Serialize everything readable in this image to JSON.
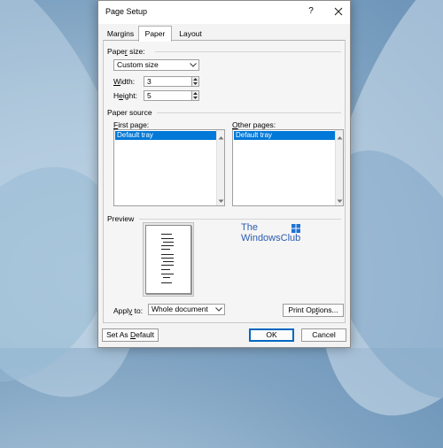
{
  "dialog": {
    "title": "Page Setup",
    "help_label": "?",
    "tabs": [
      {
        "label": "Margins",
        "active": false
      },
      {
        "label": "Paper",
        "active": true
      },
      {
        "label": "Layout",
        "active": false
      }
    ]
  },
  "paper_size": {
    "section_label_pre": "Pape",
    "section_label_u": "r",
    "section_label_post": " size:",
    "selected": "Custom size",
    "width_label_u": "W",
    "width_label_post": "idth:",
    "width_value": "3",
    "height_label_pre": "H",
    "height_label_u": "e",
    "height_label_post": "ight:",
    "height_value": "5"
  },
  "paper_source": {
    "section_label": "Paper source",
    "first_page_label_pre": "",
    "first_page_label_u": "F",
    "first_page_label_post": "irst page:",
    "first_page_selected": "Default tray",
    "other_pages_label_u": "O",
    "other_pages_label_post": "ther pages:",
    "other_pages_selected": "Default tray"
  },
  "preview": {
    "section_label": "Preview",
    "apply_to_label_pre": "Appl",
    "apply_to_label_u": "y",
    "apply_to_label_post": " to:",
    "apply_to_selected": "Whole document",
    "print_options_pre": "Print Op",
    "print_options_u": "t",
    "print_options_post": "ions..."
  },
  "watermark": {
    "line1": "The",
    "line2": "WindowsClub"
  },
  "footer": {
    "set_default_pre": "Set As ",
    "set_default_u": "D",
    "set_default_post": "efault",
    "ok_label": "OK",
    "cancel_label": "Cancel"
  },
  "colors": {
    "selection": "#0078d7",
    "accent": "#0067c0"
  }
}
